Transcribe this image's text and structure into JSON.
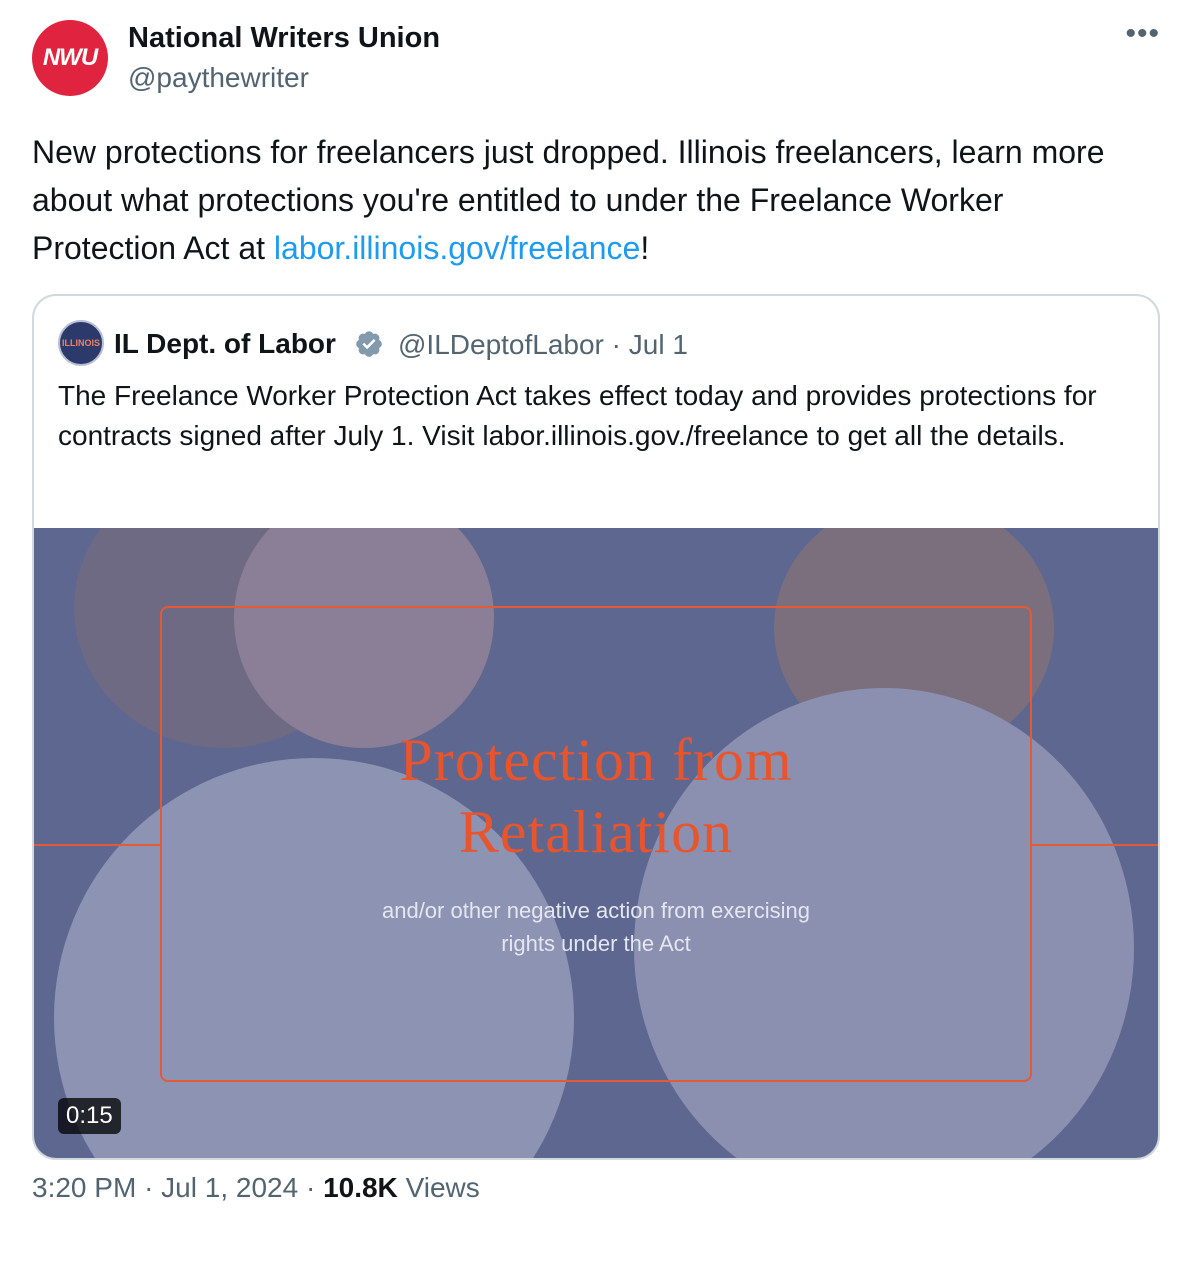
{
  "author": {
    "avatar_text": "NWU",
    "name": "National Writers Union",
    "handle": "@paythewriter"
  },
  "more_icon": "more-horizontal-icon",
  "tweet": {
    "text_before_link": "New protections for freelancers just dropped. Illinois freelancers, learn more about what protections you're entitled to under the Freelance Worker Protection Act at ",
    "link_text": "labor.illinois.gov/freelance",
    "text_after_link": "!"
  },
  "quote": {
    "avatar_text": "ILLINOIS",
    "name": "IL Dept. of Labor",
    "verified_icon": "verified-badge-icon",
    "handle": "@ILDeptofLabor",
    "separator": "·",
    "date": "Jul 1",
    "text": "The Freelance Worker Protection Act takes effect today and provides protections for contracts signed after July 1. Visit labor.illinois.gov./freelance to get all the details.",
    "media": {
      "title_line1": "Protection from",
      "title_line2": "Retaliation",
      "subtitle_line1": "and/or other negative action from exercising",
      "subtitle_line2": "rights under the Act",
      "duration": "0:15"
    }
  },
  "meta": {
    "time": "3:20 PM",
    "separator1": "·",
    "date": "Jul 1, 2024",
    "separator2": "·",
    "views_count": "10.8K",
    "views_label": "Views"
  },
  "colors": {
    "link": "#1d9bf0",
    "secondary_text": "#536471",
    "accent_orange": "#e45a35",
    "avatar_red": "#e0243f"
  }
}
